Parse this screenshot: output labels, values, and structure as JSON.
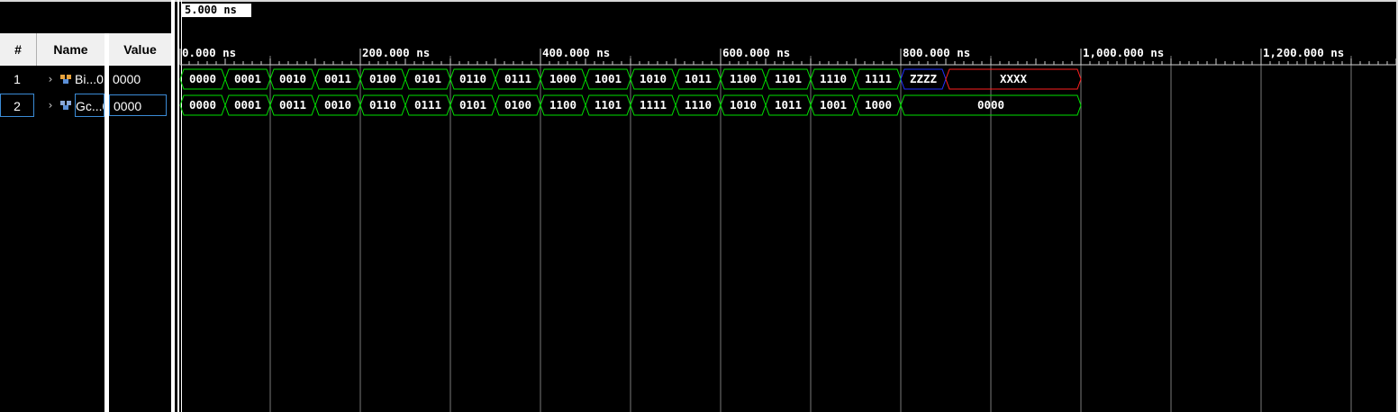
{
  "columns": {
    "number": "#",
    "name": "Name",
    "value": "Value"
  },
  "cursor_label": "5.000 ns",
  "timeline": {
    "labels": [
      "0.000 ns",
      "200.000 ns",
      "400.000 ns",
      "600.000 ns",
      "800.000 ns",
      "1,000.000 ns",
      "1,200.000 ns"
    ]
  },
  "signals": [
    {
      "index": "1",
      "name": "Bi...0",
      "value": "0000",
      "icon_color": "#e8a33d",
      "segments": [
        "0000",
        "0001",
        "0010",
        "0011",
        "0100",
        "0101",
        "0110",
        "0111",
        "1000",
        "1001",
        "1010",
        "1011",
        "1100",
        "1101",
        "1110",
        "1111",
        "ZZZZ",
        "XXXX"
      ],
      "segment_colors": [
        "#00e000",
        "#00e000",
        "#00e000",
        "#00e000",
        "#00e000",
        "#00e000",
        "#00e000",
        "#00e000",
        "#00e000",
        "#00e000",
        "#00e000",
        "#00e000",
        "#00e000",
        "#00e000",
        "#00e000",
        "#00e000",
        "#2030ff",
        "#ff2020"
      ]
    },
    {
      "index": "2",
      "name": "Gc...0",
      "value": "0000",
      "icon_color": "#8aa8d8",
      "segments": [
        "0000",
        "0001",
        "0011",
        "0010",
        "0110",
        "0111",
        "0101",
        "0100",
        "1100",
        "1101",
        "1111",
        "1110",
        "1010",
        "1011",
        "1001",
        "1000",
        "0000"
      ],
      "segment_colors": [
        "#00e000",
        "#00e000",
        "#00e000",
        "#00e000",
        "#00e000",
        "#00e000",
        "#00e000",
        "#00e000",
        "#00e000",
        "#00e000",
        "#00e000",
        "#00e000",
        "#00e000",
        "#00e000",
        "#00e000",
        "#00e000",
        "#00e000"
      ]
    }
  ]
}
